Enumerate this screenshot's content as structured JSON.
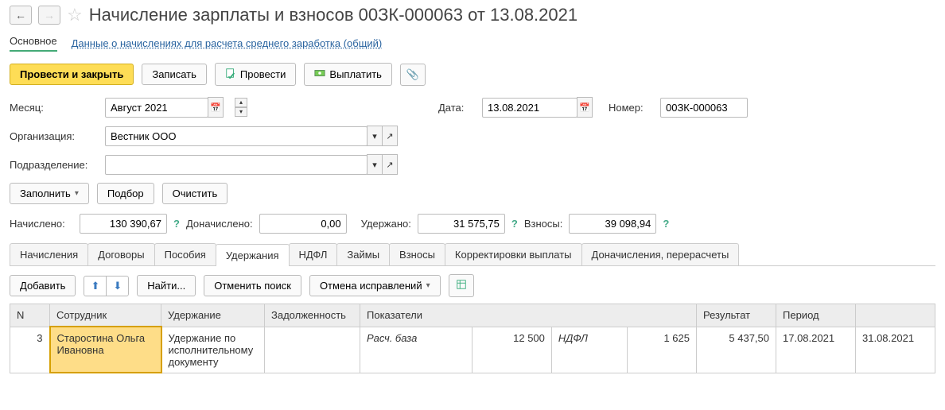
{
  "header": {
    "title": "Начисление зарплаты и взносов 00ЗК-000063 от 13.08.2021"
  },
  "mainTabs": {
    "main": "Основное",
    "link": "Данные о начислениях для расчета среднего заработка (общий)"
  },
  "toolbar": {
    "postClose": "Провести и закрыть",
    "save": "Записать",
    "post": "Провести",
    "pay": "Выплатить"
  },
  "form": {
    "monthLabel": "Месяц:",
    "monthValue": "Август 2021",
    "dateLabel": "Дата:",
    "dateValue": "13.08.2021",
    "numberLabel": "Номер:",
    "numberValue": "00ЗК-000063",
    "orgLabel": "Организация:",
    "orgValue": "Вестник ООО",
    "deptLabel": "Подразделение:",
    "deptValue": ""
  },
  "actions": {
    "fill": "Заполнить",
    "select": "Подбор",
    "clear": "Очистить"
  },
  "totals": {
    "accruedLabel": "Начислено:",
    "accruedValue": "130 390,67",
    "additionalLabel": "Доначислено:",
    "additionalValue": "0,00",
    "withheldLabel": "Удержано:",
    "withheldValue": "31 575,75",
    "contribLabel": "Взносы:",
    "contribValue": "39 098,94"
  },
  "subTabs": [
    "Начисления",
    "Договоры",
    "Пособия",
    "Удержания",
    "НДФЛ",
    "Займы",
    "Взносы",
    "Корректировки выплаты",
    "Доначисления, перерасчеты"
  ],
  "activeSubTab": "Удержания",
  "tableToolbar": {
    "add": "Добавить",
    "find": "Найти...",
    "cancelSearch": "Отменить поиск",
    "cancelCorr": "Отмена исправлений"
  },
  "table": {
    "headers": [
      "N",
      "Сотрудник",
      "Удержание",
      "Задолженность",
      "Показатели",
      "",
      "Результат",
      "Период",
      ""
    ],
    "rows": [
      {
        "n": "3",
        "employee": "Старостина Ольга Ивановна",
        "deduction": "Удержание по исполнительному документу",
        "debt": "",
        "ind1Label": "Расч. база",
        "ind1Val": "12 500",
        "ind2Label": "НДФЛ",
        "ind2Val": "1 625",
        "result": "5 437,50",
        "periodFrom": "17.08.2021",
        "periodTo": "31.08.2021"
      }
    ]
  }
}
